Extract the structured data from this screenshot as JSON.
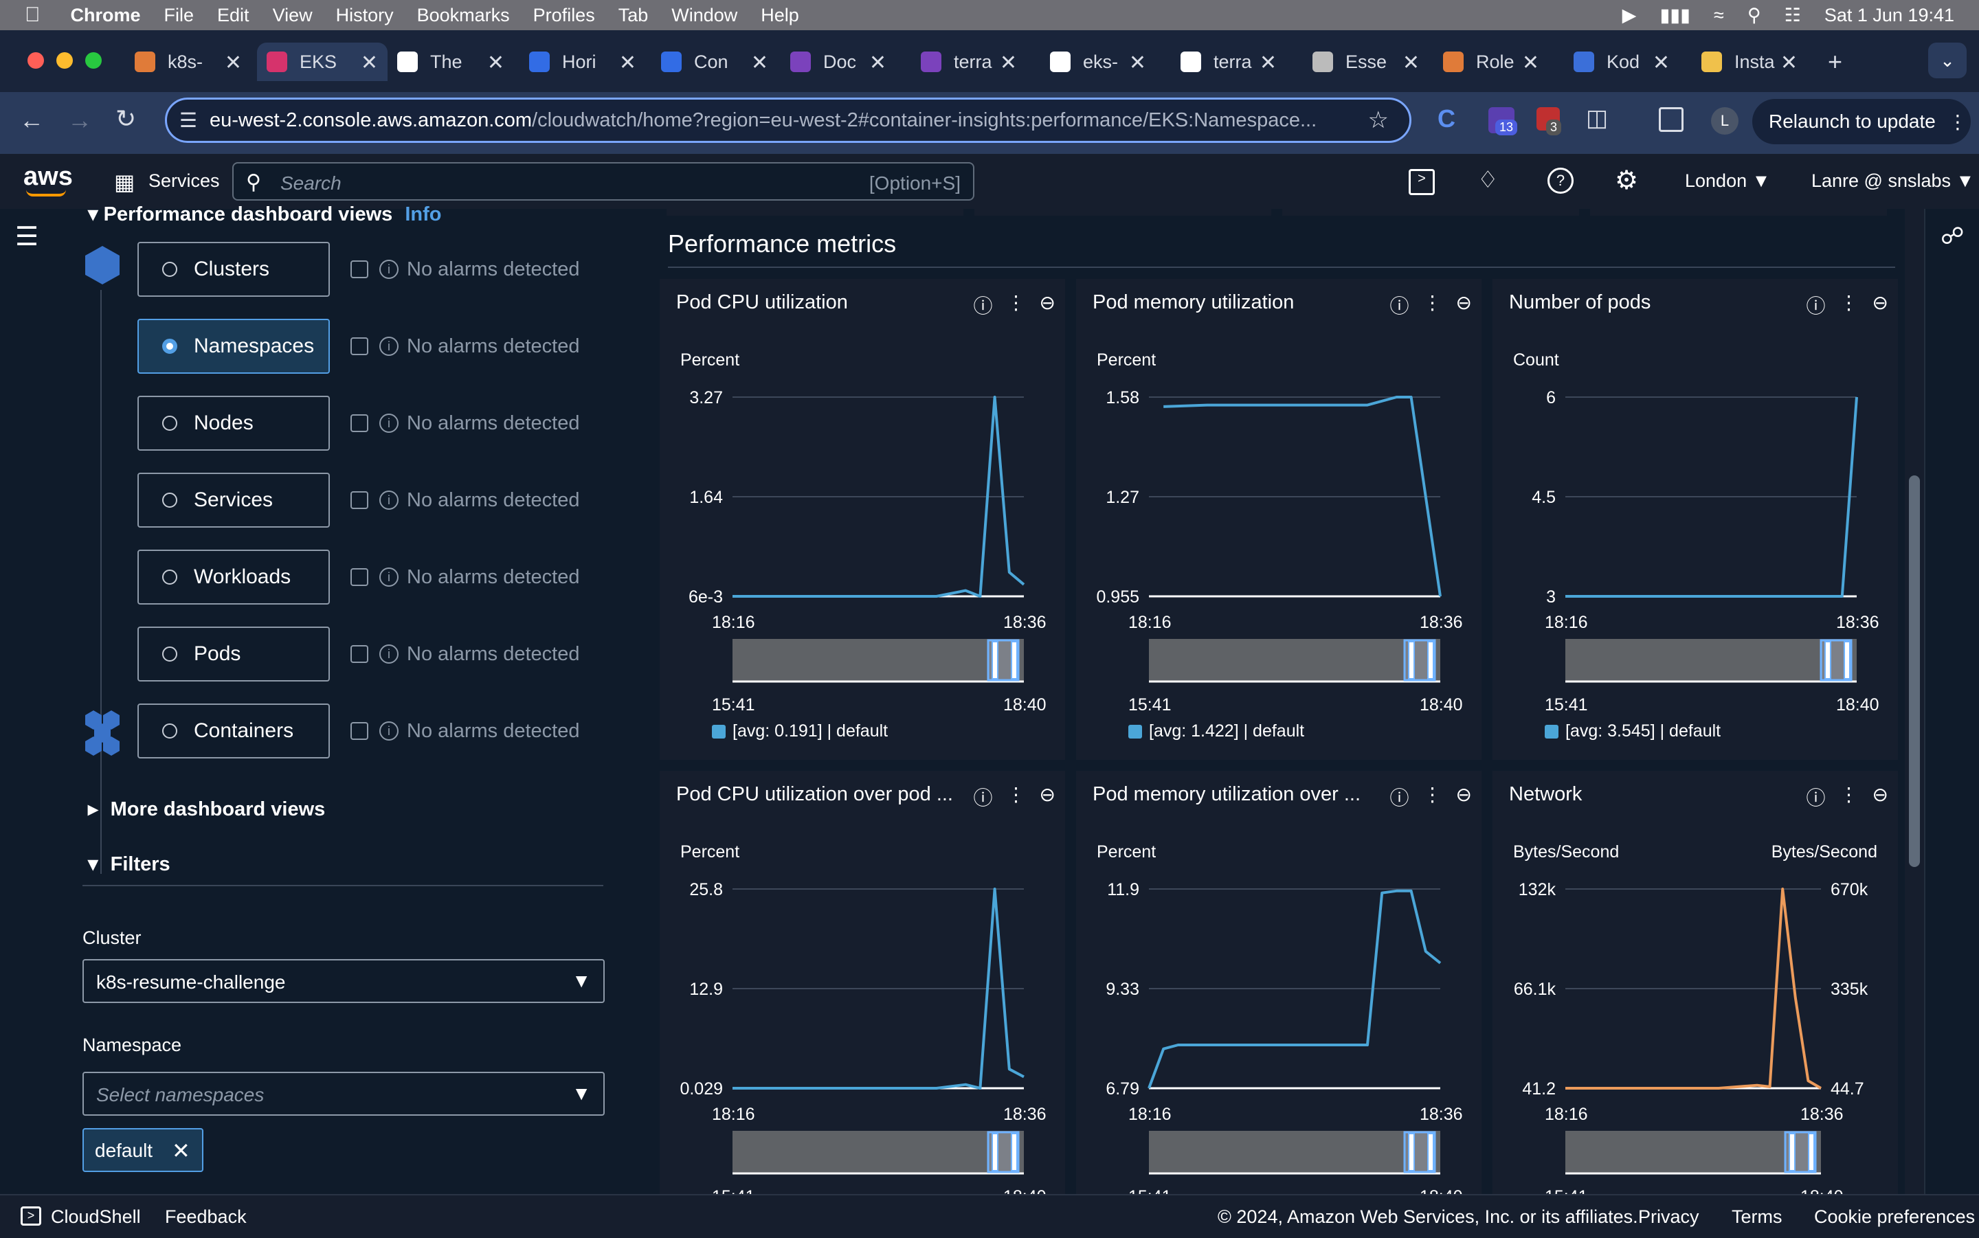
{
  "menubar": {
    "app": "Chrome",
    "items": [
      "File",
      "Edit",
      "View",
      "History",
      "Bookmarks",
      "Profiles",
      "Tab",
      "Window",
      "Help"
    ],
    "datetime": "Sat 1 Jun  19:41"
  },
  "tabs": [
    {
      "label": "k8s-",
      "color": "#e07b39"
    },
    {
      "label": "EKS",
      "color": "#d6336c",
      "active": true
    },
    {
      "label": "The",
      "color": "#ffffff"
    },
    {
      "label": "Hori",
      "color": "#326ce5"
    },
    {
      "label": "Con",
      "color": "#326ce5"
    },
    {
      "label": "Doc",
      "color": "#7b42bc"
    },
    {
      "label": "terra",
      "color": "#7b42bc"
    },
    {
      "label": "eks-",
      "color": "#ffffff"
    },
    {
      "label": "terra",
      "color": "#ffffff"
    },
    {
      "label": "Esse",
      "color": "#bbbbbb"
    },
    {
      "label": "Role",
      "color": "#e07b39"
    },
    {
      "label": "Kod",
      "color": "#3b6fd9"
    },
    {
      "label": "Insta",
      "color": "#f0c14b"
    }
  ],
  "browser": {
    "url_host": "eu-west-2.console.aws.amazon.com",
    "url_path": "/cloudwatch/home?region=eu-west-2#container-insights:performance/EKS:Namespace...",
    "relaunch": "Relaunch to update",
    "ext_badge1": "13",
    "ext_badge2": "3",
    "profile_initial": "L"
  },
  "aws": {
    "logo": "aws",
    "services": "Services",
    "search_placeholder": "Search",
    "search_shortcut": "[Option+S]",
    "region": "London ▼",
    "account": "Lanre @ snslabs ▼"
  },
  "panel": {
    "section_title": "Performance dashboard views",
    "info": "Info",
    "views": [
      {
        "label": "Clusters",
        "alarm": "No alarms detected"
      },
      {
        "label": "Namespaces",
        "alarm": "No alarms detected",
        "selected": true
      },
      {
        "label": "Nodes",
        "alarm": "No alarms detected"
      },
      {
        "label": "Services",
        "alarm": "No alarms detected"
      },
      {
        "label": "Workloads",
        "alarm": "No alarms detected"
      },
      {
        "label": "Pods",
        "alarm": "No alarms detected"
      },
      {
        "label": "Containers",
        "alarm": "No alarms detected"
      }
    ],
    "more_views": "More dashboard views",
    "filters": "Filters",
    "cluster_label": "Cluster",
    "cluster_value": "k8s-resume-challenge",
    "namespace_label": "Namespace",
    "namespace_placeholder": "Select namespaces",
    "token": "default"
  },
  "main": {
    "heading": "Performance metrics",
    "cards": [
      {
        "title": "Pod CPU utilization",
        "unit": "Percent",
        "legend": "[avg: 0.191] | default"
      },
      {
        "title": "Pod memory utilization",
        "unit": "Percent",
        "legend": "[avg: 1.422] | default"
      },
      {
        "title": "Number of pods",
        "unit": "Count",
        "legend": "[avg: 3.545] | default"
      },
      {
        "title": "Pod CPU utilization over pod ...",
        "unit": "Percent"
      },
      {
        "title": "Pod memory utilization over ...",
        "unit": "Percent"
      },
      {
        "title": "Network",
        "unit": "Bytes/Second",
        "unit_right": "Bytes/Second"
      }
    ],
    "time_start": "18:16",
    "time_end": "18:36",
    "nav_start": "15:41",
    "nav_end": "18:40"
  },
  "chart_data": [
    {
      "type": "line",
      "title": "Pod CPU utilization",
      "ylabel": "Percent",
      "yticks": [
        "6e-3",
        "1.64",
        "3.27"
      ],
      "ylim": [
        0.006,
        3.27
      ],
      "x": [
        "18:16",
        "18:18",
        "18:20",
        "18:22",
        "18:24",
        "18:26",
        "18:28",
        "18:30",
        "18:32",
        "18:33",
        "18:34",
        "18:35",
        "18:36"
      ],
      "series": [
        {
          "name": "default",
          "color": "#4ba6d8",
          "values": [
            0.006,
            0.006,
            0.006,
            0.006,
            0.006,
            0.006,
            0.006,
            0.006,
            0.1,
            0.006,
            3.27,
            0.4,
            0.2
          ]
        }
      ]
    },
    {
      "type": "line",
      "title": "Pod memory utilization",
      "ylabel": "Percent",
      "yticks": [
        "0.955",
        "1.27",
        "1.58"
      ],
      "ylim": [
        0.955,
        1.58
      ],
      "x": [
        "18:17",
        "18:20",
        "18:24",
        "18:28",
        "18:31",
        "18:33",
        "18:34",
        "18:36"
      ],
      "series": [
        {
          "name": "default",
          "color": "#4ba6d8",
          "values": [
            1.55,
            1.555,
            1.555,
            1.555,
            1.555,
            1.58,
            1.58,
            0.955
          ]
        }
      ]
    },
    {
      "type": "line",
      "title": "Number of pods",
      "ylabel": "Count",
      "yticks": [
        "3",
        "4.5",
        "6"
      ],
      "ylim": [
        3,
        6
      ],
      "x": [
        "18:16",
        "18:20",
        "18:24",
        "18:28",
        "18:32",
        "18:35",
        "18:36"
      ],
      "series": [
        {
          "name": "default",
          "color": "#4ba6d8",
          "values": [
            3,
            3,
            3,
            3,
            3,
            3,
            6
          ]
        }
      ]
    },
    {
      "type": "line",
      "title": "Pod CPU utilization over pod ...",
      "ylabel": "Percent",
      "yticks": [
        "0.029",
        "12.9",
        "25.8"
      ],
      "ylim": [
        0.029,
        25.8
      ],
      "x": [
        "18:16",
        "18:18",
        "18:20",
        "18:22",
        "18:24",
        "18:26",
        "18:28",
        "18:30",
        "18:32",
        "18:33",
        "18:34",
        "18:35",
        "18:36"
      ],
      "series": [
        {
          "name": "default",
          "color": "#4ba6d8",
          "values": [
            0.029,
            0.029,
            0.029,
            0.029,
            0.029,
            0.029,
            0.029,
            0.029,
            0.5,
            0.029,
            25.8,
            2.5,
            1.5
          ]
        }
      ]
    },
    {
      "type": "line",
      "title": "Pod memory utilization over ...",
      "ylabel": "Percent",
      "yticks": [
        "6.79",
        "9.33",
        "11.9"
      ],
      "ylim": [
        6.79,
        11.9
      ],
      "x": [
        "18:16",
        "18:17",
        "18:18",
        "18:21",
        "18:24",
        "18:28",
        "18:31",
        "18:32",
        "18:33",
        "18:34",
        "18:35",
        "18:36"
      ],
      "series": [
        {
          "name": "default",
          "color": "#4ba6d8",
          "values": [
            6.79,
            7.8,
            7.9,
            7.9,
            7.9,
            7.9,
            7.9,
            11.8,
            11.85,
            11.85,
            10.3,
            10.0
          ]
        }
      ]
    },
    {
      "type": "line",
      "title": "Network",
      "ylabel": "Bytes/Second",
      "y2label": "Bytes/Second",
      "yticks": [
        "41.2",
        "66.1k",
        "132k"
      ],
      "y2ticks": [
        "44.7",
        "335k",
        "670k"
      ],
      "ylim": [
        41.2,
        132000
      ],
      "x": [
        "18:16",
        "18:20",
        "18:24",
        "18:28",
        "18:31",
        "18:32",
        "18:33",
        "18:34",
        "18:35",
        "18:36"
      ],
      "series": [
        {
          "name": "default",
          "color": "#ec9b5b",
          "values": [
            41.2,
            41.2,
            41.2,
            41.2,
            2000,
            1000,
            132000,
            60000,
            5000,
            41.2
          ]
        }
      ]
    }
  ]
}
